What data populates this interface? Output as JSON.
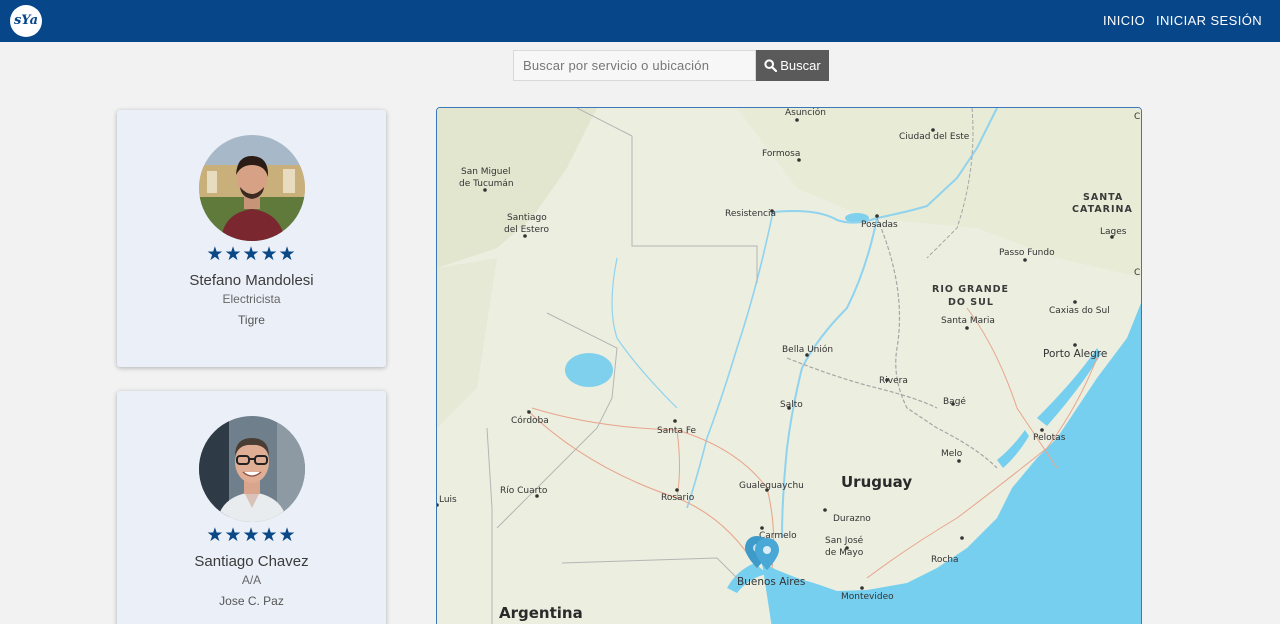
{
  "navbar": {
    "logo_text": "sYa",
    "links": {
      "inicio": "INICIO",
      "login": "INICIAR SESIÓN"
    },
    "color": "#08468a"
  },
  "search": {
    "placeholder": "Buscar por servicio o ubicación",
    "button_label": "Buscar"
  },
  "profiles": [
    {
      "name": "Stefano Mandolesi",
      "role": "Electricista",
      "location": "Tigre",
      "rating": "★★★★★",
      "rating_value": 5
    },
    {
      "name": "Santiago Chavez",
      "role": "A/A",
      "location": "Jose C. Paz",
      "rating": "★★★★★",
      "rating_value": 5
    }
  ],
  "map": {
    "cities": {
      "asuncion": "Asunción",
      "ciudad_del_este": "Ciudad del Este",
      "formosa": "Formosa",
      "san_miguel_1": "San Miguel",
      "san_miguel_2": "de Tucumán",
      "resistencia": "Resistencia",
      "posadas": "Posadas",
      "santiago_1": "Santiago",
      "santiago_2": "del Estero",
      "lages": "Lages",
      "passo_fundo": "Passo Fundo",
      "santa_maria": "Santa Maria",
      "caxias": "Caxias do Sul",
      "porto_alegre": "Porto Alegre",
      "bella_union": "Bella Unión",
      "rivera": "Rivera",
      "salto": "Salto",
      "cordoba": "Córdoba",
      "santa_fe": "Santa Fe",
      "bage": "Bagé",
      "pelotas": "Pelotas",
      "melo": "Melo",
      "luis": "Luis",
      "rio_cuarto": "Río Cuarto",
      "rosario": "Rosario",
      "gualeguaychu": "Gualeguaychu",
      "durazno": "Durazno",
      "carmelo": "Carmelo",
      "san_jose_1": "San José",
      "san_jose_2": "de Mayo",
      "rocha": "Rocha",
      "buenos_aires": "Buenos Aires",
      "montevideo": "Montevideo"
    },
    "regions": {
      "santa_catarina_1": "SANTA",
      "santa_catarina_2": "CATARINA",
      "rio_grande_1": "RIO GRANDE",
      "rio_grande_2": "DO SUL"
    },
    "countries": {
      "uruguay": "Uruguay",
      "argentina": "Argentina"
    },
    "edge_labels": {
      "c_top": "C",
      "c_mid": "C"
    },
    "marker_color": "#3d9ac9",
    "water_color": "#76cfee"
  }
}
